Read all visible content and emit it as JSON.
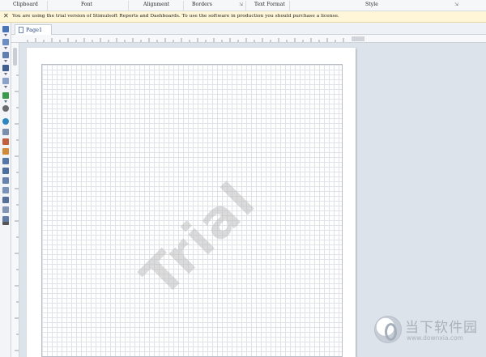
{
  "ribbon": {
    "groups": [
      "Clipboard",
      "Font",
      "Alignment",
      "Borders",
      "Text Format",
      "Style"
    ]
  },
  "notice": {
    "close": "✕",
    "message": "You are using the trial version of Stimulsoft Reports and Dashboards. To use the software in production you should purchase a license."
  },
  "tabs": [
    {
      "label": "Page1"
    }
  ],
  "canvas": {
    "watermark": "Trial"
  },
  "logo": {
    "name": "当下软件园",
    "url": "www.downxia.com"
  },
  "toolbox": {
    "icons": [
      "select-icon",
      "text-icon",
      "richtext-icon",
      "image-icon",
      "barcode-icon",
      "shape-icon",
      "chart-icon",
      "gauge-icon",
      "map-icon",
      "table-icon",
      "panel-icon",
      "databand-icon",
      "header-icon",
      "footer-icon",
      "group-icon",
      "subreport-icon",
      "crosstab-icon",
      "checkbox-icon",
      "zipcode-icon",
      "sparkline-icon",
      "tools-icon"
    ]
  }
}
